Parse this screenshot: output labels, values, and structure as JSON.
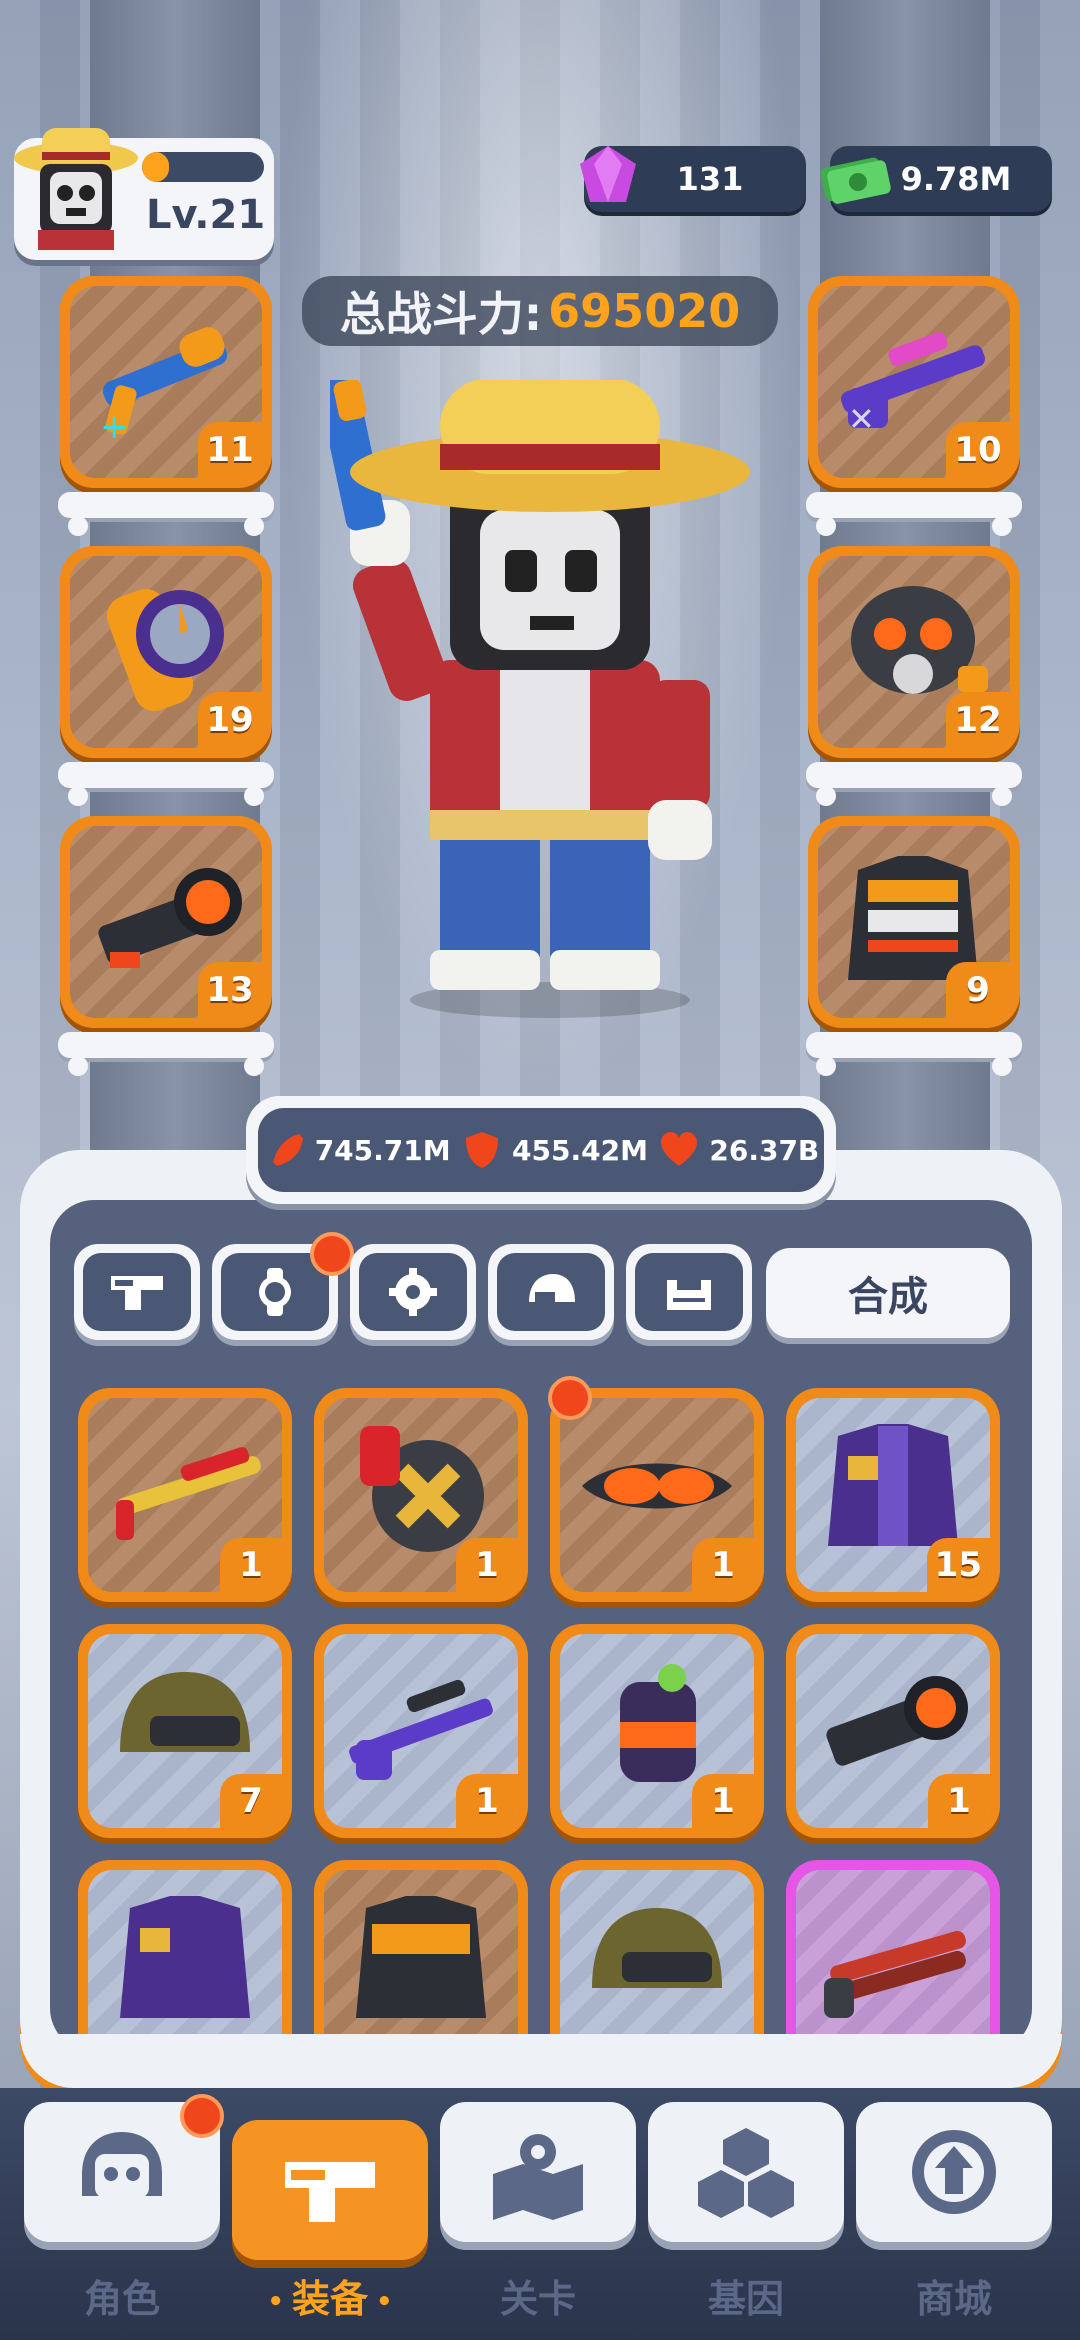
{
  "player": {
    "level": "Lv.21",
    "xp_fraction": 0.22
  },
  "currency": {
    "gems": "131",
    "cash": "9.78M"
  },
  "power": {
    "label": "总战斗力:",
    "value": "695020"
  },
  "equipped_left": [
    {
      "name": "blaster",
      "count": "11"
    },
    {
      "name": "watch",
      "count": "19"
    },
    {
      "name": "scope",
      "count": "13"
    }
  ],
  "equipped_right": [
    {
      "name": "rifle",
      "count": "10"
    },
    {
      "name": "gas-mask",
      "count": "12"
    },
    {
      "name": "jacket",
      "count": "9"
    }
  ],
  "stats": {
    "attack": "745.71M",
    "defense": "455.42M",
    "health": "26.37B"
  },
  "tabs": {
    "merge_label": "合成"
  },
  "inventory": [
    {
      "name": "shotgun",
      "count": "1"
    },
    {
      "name": "ammo-drum",
      "count": "1"
    },
    {
      "name": "goggles",
      "count": "1",
      "badge": true
    },
    {
      "name": "purple-jacket",
      "count": "15"
    },
    {
      "name": "helmet",
      "count": "7"
    },
    {
      "name": "sniper-rifle",
      "count": "1"
    },
    {
      "name": "grenade",
      "count": "1"
    },
    {
      "name": "scope",
      "count": "1"
    },
    {
      "name": "purple-jacket",
      "count": ""
    },
    {
      "name": "armor-vest",
      "count": ""
    },
    {
      "name": "helmet",
      "count": ""
    },
    {
      "name": "double-barrel",
      "count": "",
      "rarity": "epic"
    }
  ],
  "nav": [
    {
      "label": "角色",
      "icon": "skull-icon"
    },
    {
      "label": "装备",
      "icon": "gun-icon",
      "active": true
    },
    {
      "label": "关卡",
      "icon": "map-icon"
    },
    {
      "label": "基因",
      "icon": "gene-icon"
    },
    {
      "label": "商城",
      "icon": "shop-icon"
    }
  ],
  "colors": {
    "accent": "#f08a18",
    "panel": "#56627d",
    "badge": "#f0461c"
  }
}
